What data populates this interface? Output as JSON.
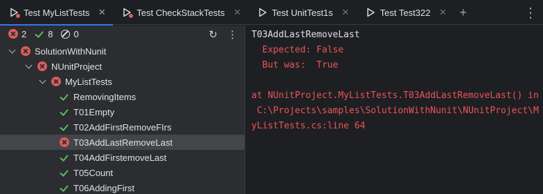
{
  "tabs": [
    {
      "label": "Test MyListTests",
      "active": true,
      "failed": true
    },
    {
      "label": "Test CheckStackTests",
      "active": false,
      "failed": true
    },
    {
      "label": "Test UnitTest1s",
      "active": false,
      "failed": false
    },
    {
      "label": "Test Test322",
      "active": false,
      "failed": false
    }
  ],
  "counters": {
    "failed": "2",
    "passed": "8",
    "ignored": "0"
  },
  "tree": [
    {
      "label": "SolutionWithNunit",
      "status": "failed",
      "level": 0,
      "expandable": true
    },
    {
      "label": "NUnitProject",
      "status": "failed",
      "level": 1,
      "expandable": true
    },
    {
      "label": "MyListTests",
      "status": "failed",
      "level": 2,
      "expandable": true
    },
    {
      "label": "RemovingItems",
      "status": "passed",
      "level": 3,
      "expandable": false
    },
    {
      "label": "T01Empty",
      "status": "passed",
      "level": 3,
      "expandable": false
    },
    {
      "label": "T02AddFirstRemoveFIrs",
      "status": "passed",
      "level": 3,
      "expandable": false
    },
    {
      "label": "T03AddLastRemoveLast",
      "status": "failed",
      "level": 3,
      "expandable": false,
      "selected": true
    },
    {
      "label": "T04AddFirstemoveLast",
      "status": "passed",
      "level": 3,
      "expandable": false
    },
    {
      "label": "T05Count",
      "status": "passed",
      "level": 3,
      "expandable": false
    },
    {
      "label": "T06AddingFirst",
      "status": "passed",
      "level": 3,
      "expandable": false
    }
  ],
  "output": {
    "title": "T03AddLastRemoveLast",
    "lines": [
      "  Expected: False",
      "  But was:  True",
      "",
      "at NUnitProject.MyListTests.T03AddLastRemoveLast() in",
      " C:\\Projects\\samples\\SolutionWithNunit\\NUnitProject\\M",
      "yListTests.cs:line 64"
    ]
  },
  "colors": {
    "failed": "#db5c5c",
    "passed": "#5fb865",
    "accent": "#3574f0",
    "error_text": "#e8555a"
  }
}
